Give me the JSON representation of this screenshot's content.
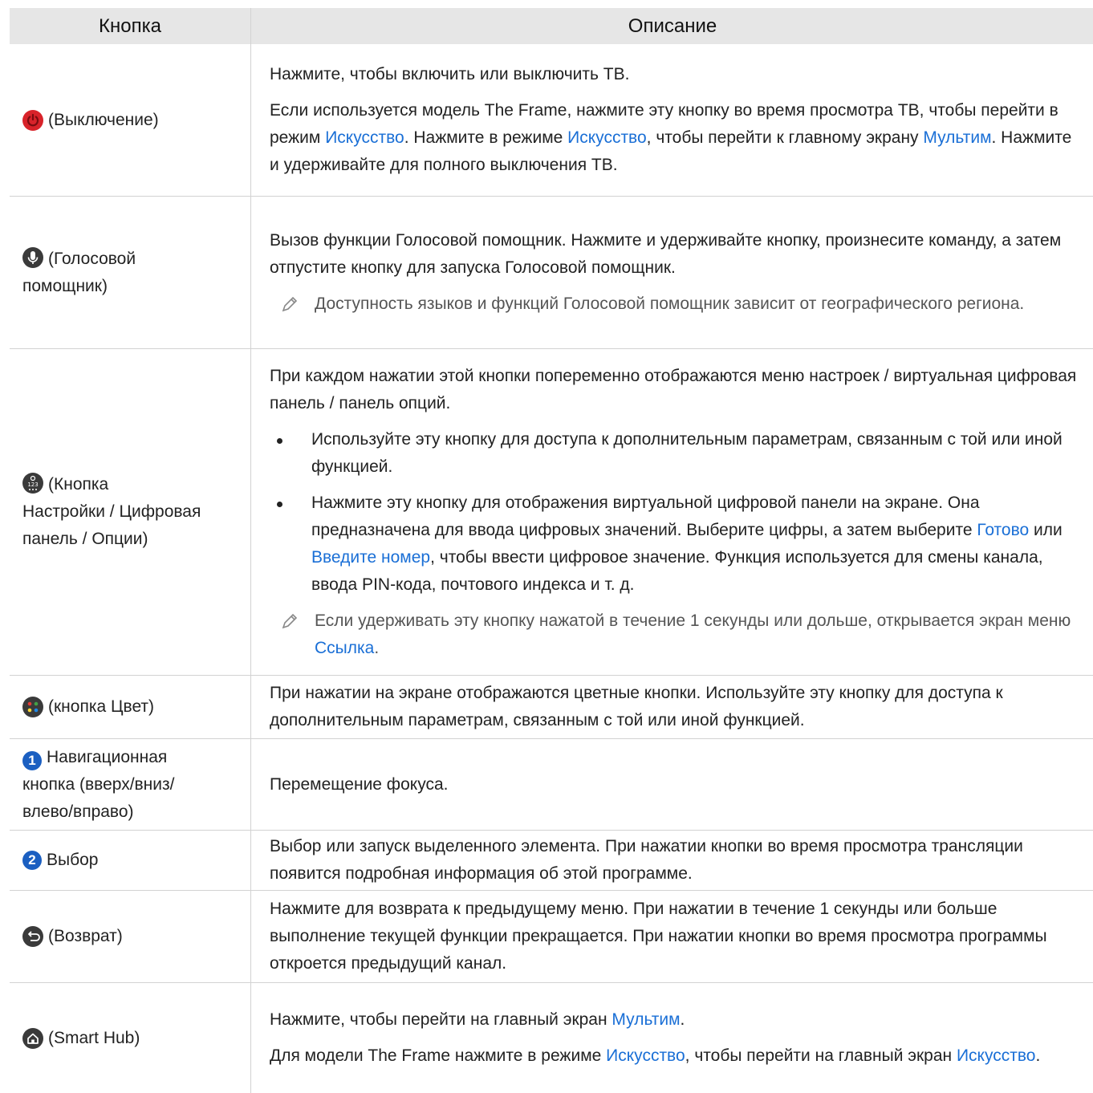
{
  "header": {
    "col1": "Кнопка",
    "col2": "Описание"
  },
  "rows": [
    {
      "icon": "power-icon",
      "button": "(Выключение)",
      "p1": "Нажмите, чтобы включить или выключить ТВ.",
      "p2a": "Если используется модель The Frame, нажмите эту кнопку во время просмотра ТВ, чтобы перейти в режим ",
      "p2b": "Искусство",
      "p2c": ". Нажмите в режиме ",
      "p2d": "Искусство",
      "p2e": ", чтобы перейти к главному экрану ",
      "p2f": "Мультим",
      "p2g": ". Нажмите и удерживайте для полного выключения ТВ."
    },
    {
      "icon": "microphone-icon",
      "button_l1": "(Голосовой",
      "button_l2": "помощник)",
      "p1": "Вызов функции Голосовой помощник. Нажмите и удерживайте кнопку, произнесите команду, а затем отпустите кнопку для запуска Голосовой помощник.",
      "note": "Доступность языков и функций Голосовой помощник зависит от географического региона."
    },
    {
      "icon": "settings-numpad-icon",
      "button_l1": "(Кнопка",
      "button_l2": "Настройки / Цифровая",
      "button_l3": "панель / Опции)",
      "p1": "При каждом нажатии этой кнопки попеременно отображаются меню настроек / виртуальная цифровая панель / панель опций.",
      "b1": "Используйте эту кнопку для доступа к дополнительным параметрам, связанным с той или иной функцией.",
      "b2a": "Нажмите эту кнопку для отображения виртуальной цифровой панели на экране. Она предназначена для ввода цифровых значений. Выберите цифры, а затем выберите ",
      "b2b": "Готово",
      "b2c": " или ",
      "b2d": "Введите номер",
      "b2e": ", чтобы ввести цифровое значение. Функция используется для смены канала, ввода PIN-кода, почтового индекса и т. д.",
      "note_a": "Если удерживать эту кнопку нажатой в течение 1 секунды или дольше, открывается экран меню ",
      "note_b": "Ссылка",
      "note_c": "."
    },
    {
      "icon": "color-button-icon",
      "button": "(кнопка Цвет)",
      "p1": "При нажатии на экране отображаются цветные кнопки. Используйте эту кнопку для доступа к дополнительным параметрам, связанным с той или иной функцией."
    },
    {
      "icon": "number-1-icon",
      "num": "1",
      "button_l1": "Навигационная",
      "button_l2": "кнопка (вверх/вниз/",
      "button_l3": "влево/вправо)",
      "p1": "Перемещение фокуса."
    },
    {
      "icon": "number-2-icon",
      "num": "2",
      "button": "Выбор",
      "p1": "Выбор или запуск выделенного элемента. При нажатии кнопки во время просмотра трансляции появится подробная информация об этой программе."
    },
    {
      "icon": "return-icon",
      "button": "(Возврат)",
      "p1": "Нажмите для возврата к предыдущему меню. При нажатии в течение 1 секунды или больше выполнение текущей функции прекращается. При нажатии кнопки во время просмотра программы откроется предыдущий канал."
    },
    {
      "icon": "home-icon",
      "button": "(Smart Hub)",
      "p1a": "Нажмите, чтобы перейти на главный экран ",
      "p1b": "Мультим",
      "p1c": ".",
      "p2a": "Для модели The Frame нажмите в режиме ",
      "p2b": "Искусство",
      "p2c": ", чтобы перейти на главный экран ",
      "p2d": "Искусство",
      "p2e": "."
    }
  ],
  "colors": {
    "header_bg": "#e6e6e6",
    "link": "#1a6fd6",
    "power": "#d8232a",
    "icon_dark": "#3a3a3a",
    "badge_blue": "#1b5fc1"
  }
}
